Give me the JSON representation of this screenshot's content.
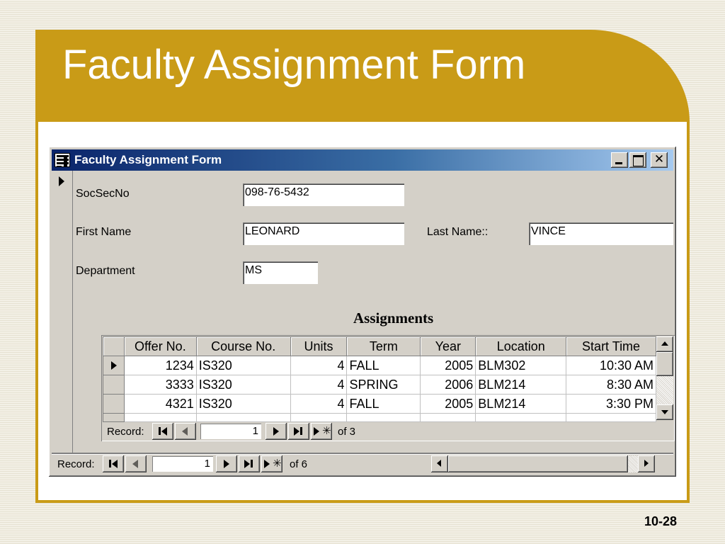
{
  "slide": {
    "title": "Faculty Assignment Form",
    "number": "10-28",
    "frame_color": "#c99b17"
  },
  "window": {
    "title": "Faculty Assignment Form",
    "icon": "form-icon",
    "controls": [
      "minimize",
      "maximize",
      "close"
    ]
  },
  "form": {
    "socsecno_label": "SocSecNo",
    "socsecno_value": "098-76-5432",
    "firstname_label": "First Name",
    "firstname_value": "LEONARD",
    "lastname_label": "Last Name::",
    "lastname_value": "VINCE",
    "department_label": "Department",
    "department_value": "MS"
  },
  "subform": {
    "title": "Assignments",
    "columns": [
      "Offer No.",
      "Course No.",
      "Units",
      "Term",
      "Year",
      "Location",
      "Start Time"
    ],
    "rows": [
      {
        "offer": "1234",
        "course": "IS320",
        "units": "4",
        "term": "FALL",
        "year": "2005",
        "location": "BLM302",
        "start": "10:30 AM"
      },
      {
        "offer": "3333",
        "course": "IS320",
        "units": "4",
        "term": "SPRING",
        "year": "2006",
        "location": "BLM214",
        "start": "8:30 AM"
      },
      {
        "offer": "4321",
        "course": "IS320",
        "units": "4",
        "term": "FALL",
        "year": "2005",
        "location": "BLM214",
        "start": "3:30 PM"
      }
    ],
    "nav": {
      "label": "Record:",
      "current": "1",
      "of_text": "of 3"
    }
  },
  "main_nav": {
    "label": "Record:",
    "current": "1",
    "of_text": "of 6"
  }
}
